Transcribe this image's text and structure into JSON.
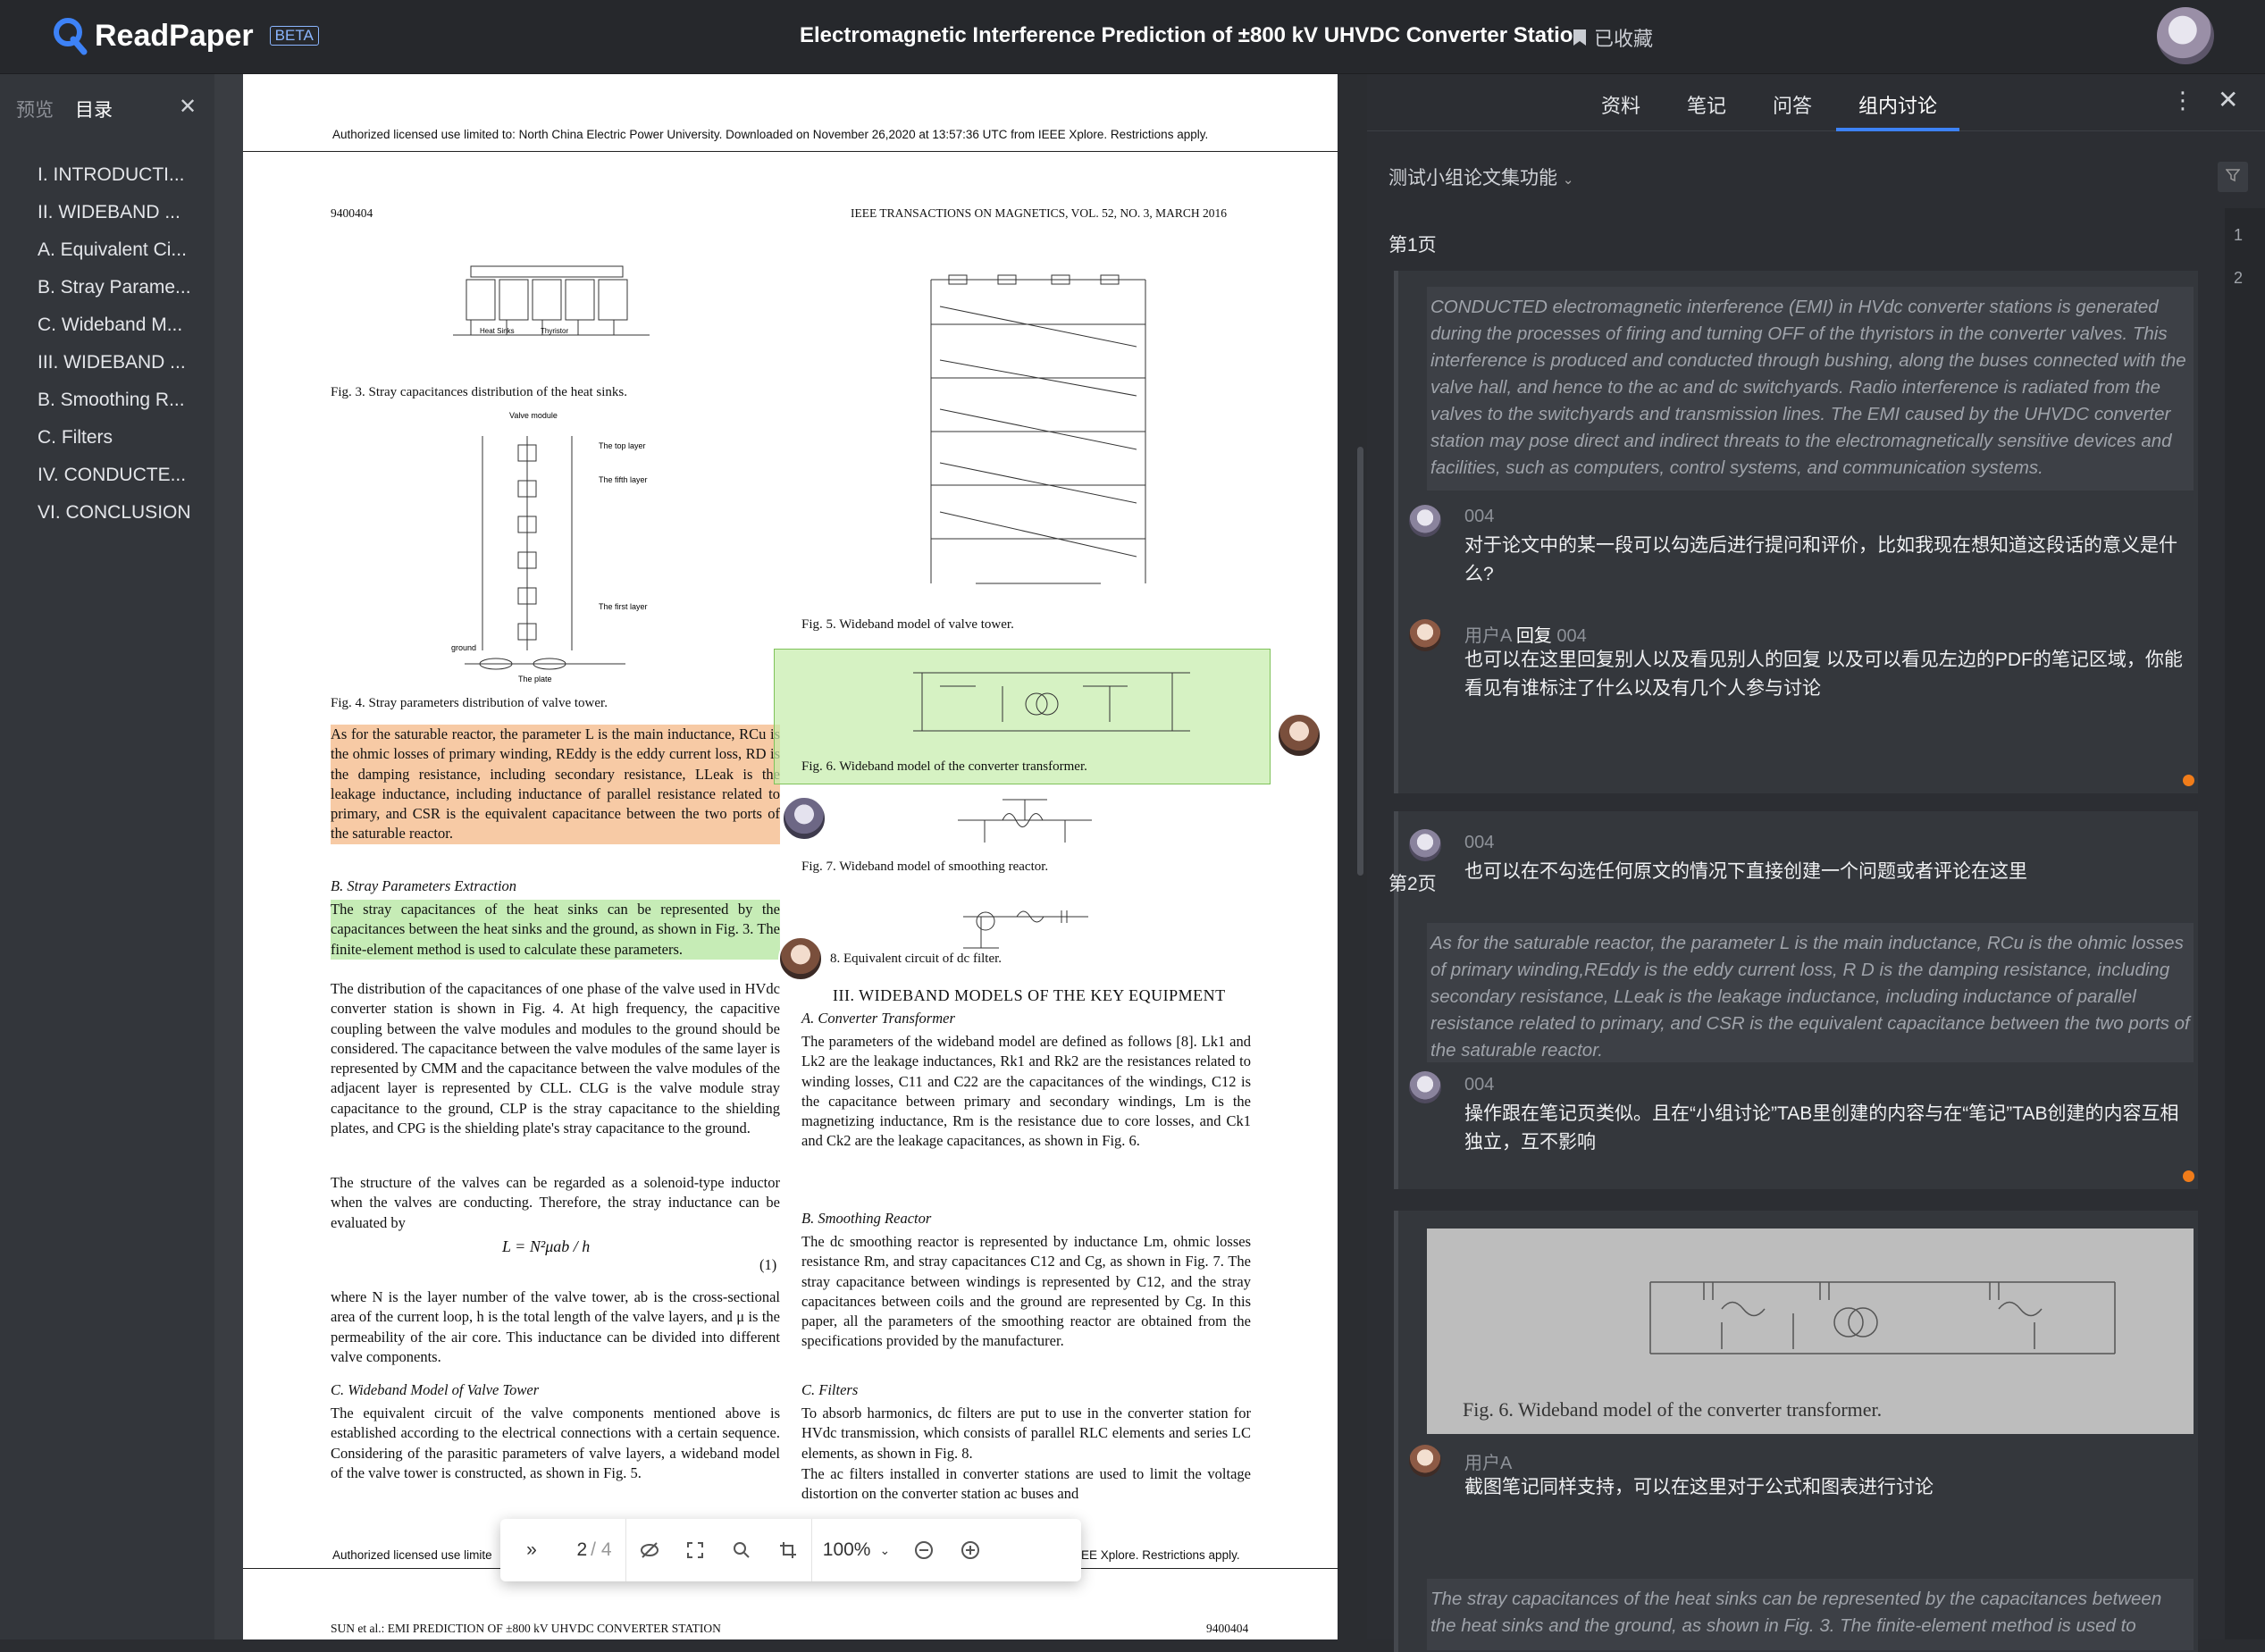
{
  "app": {
    "name": "ReadPaper",
    "badge": "BETA"
  },
  "header": {
    "title": "Electromagnetic Interference Prediction of ±800 kV UHVDC Converter Station",
    "favorite_label": "已收藏"
  },
  "left_panel": {
    "tabs": [
      "预览",
      "目录"
    ],
    "toc": [
      "I. INTRODUCTI...",
      "II. WIDEBAND ...",
      "A. Equivalent Ci...",
      "B. Stray Parame...",
      "C. Wideband M...",
      "III. WIDEBAND ...",
      "B. Smoothing R...",
      "C. Filters",
      "IV. CONDUCTE...",
      "VI. CONCLUSION"
    ]
  },
  "pdf": {
    "footer_top": "Authorized licensed use limited to: North China Electric Power University. Downloaded on November 26,2020 at 13:57:36 UTC from IEEE Xplore.  Restrictions apply.",
    "page_num": "9400404",
    "journal": "IEEE TRANSACTIONS ON MAGNETICS, VOL. 52, NO. 3, MARCH 2016",
    "fig3_caption": "Fig. 3.   Stray capacitances distribution of the heat sinks.",
    "fig4_caption": "Fig. 4.   Stray parameters distribution of valve tower.",
    "fig5_caption": "Fig. 5.   Wideband model of valve tower.",
    "fig6_caption": "Fig. 6.   Wideband model of the converter transformer.",
    "fig7_caption": "Fig. 7.   Wideband model of smoothing reactor.",
    "fig8_caption": "8.   Equivalent circuit of dc filter.",
    "para_saturable": "As for the saturable reactor, the parameter L is the main inductance, RCu is the ohmic losses of primary winding, REddy is the eddy current loss, RD is the damping resistance, including secondary resistance, LLeak is the leakage inductance, including inductance of parallel resistance related to primary, and CSR is the equivalent capacitance between the two ports of the saturable reactor.",
    "sec_b": "B. Stray Parameters Extraction",
    "para_stray_hl": "The stray capacitances of the heat sinks can be represented by the capacitances between the heat sinks and the ground, as shown in Fig. 3. The finite-element method is used to calculate these parameters.",
    "para_dist": "The distribution of the capacitances of one phase of the valve used in HVdc converter station is shown in Fig. 4. At high frequency, the capacitive coupling between the valve modules and modules to the ground should be considered. The capacitance between the valve modules of the same layer is represented by CMM and the capacitance between the valve modules of the adjacent layer is represented by CLL. CLG is the valve module stray capacitance to the ground, CLP is the stray capacitance to the shielding plates, and CPG is the shielding plate's stray capacitance to the ground.",
    "para_struct": "The structure of the valves can be regarded as a solenoid-type inductor when the valves are conducting. Therefore, the stray inductance can be evaluated by",
    "equation": "L = N²μab / h",
    "eq_num": "(1)",
    "para_where": "where N is the layer number of the valve tower, ab is the cross-sectional area of the current loop, h is the total length of the valve layers, and μ is the permeability of the air core. This inductance can be divided into different valve components.",
    "sec_c": "C. Wideband Model of Valve Tower",
    "para_equiv": "The equivalent circuit of the valve components mentioned above is established according to the electrical connections with a certain sequence. Considering of the parasitic parameters of valve layers, a wideband model of the valve tower is constructed, as shown in Fig. 5.",
    "sec_iii": "III. WIDEBAND MODELS OF THE KEY EQUIPMENT",
    "sec_iii_a": "A. Converter Transformer",
    "para_params": "The parameters of the wideband model are defined as follows [8]. Lk1 and Lk2 are the leakage inductances, Rk1 and Rk2 are the resistances related to winding losses, C11 and C22 are the capacitances of the windings, C12 is the capacitance between primary and secondary windings, Lm is the magnetizing inductance, Rm is the resistance due to core losses, and Ck1 and Ck2 are the leakage capacitances, as shown in Fig. 6.",
    "sec_iii_b": "B. Smoothing Reactor",
    "para_smooth": "The dc smoothing reactor is represented by inductance Lm, ohmic losses resistance Rm, and stray capacitances C12 and Cg, as shown in Fig. 7. The stray capacitance between windings is represented by C12, and the stray capacitances between coils and the ground are represented by Cg. In this paper, all the parameters of the smoothing reactor are obtained from the specifications provided by the manufacturer.",
    "sec_iii_c": "C. Filters",
    "para_filters": "To absorb harmonics, dc filters are put to use in the converter station for HVdc transmission, which consists of parallel RLC elements and series LC elements, as shown in Fig. 8.",
    "para_ac": "The ac filters installed in converter stations are used to limit the voltage distortion on the converter station ac buses and",
    "footer_bottom_left": "Authorized licensed use limite",
    "footer_bottom_right": "EE Xplore.  Restrictions apply.",
    "next_header_left": "SUN et al.: EMI PREDICTION OF ±800 kV UHVDC CONVERTER STATION",
    "next_header_right": "9400404",
    "fig_labels": {
      "heatsink": [
        "Heat Sinks",
        "Thyristor"
      ],
      "valve": [
        "Valve module",
        "The top layer",
        "The fifth layer",
        "The first layer",
        "The plate",
        "ground"
      ]
    }
  },
  "toolbar": {
    "page_current": "2",
    "page_total": "/ 4",
    "zoom": "100%"
  },
  "right_panel": {
    "tabs": [
      "资料",
      "笔记",
      "问答",
      "组内讨论"
    ],
    "active_tab": "组内讨论",
    "group": "测试小组论文集功能",
    "page1_label": "第1页",
    "page2_label": "第2页",
    "scroll_nums": [
      "1",
      "2"
    ],
    "card1": {
      "quote": "CONDUCTED electromagnetic interference (EMI) in HVdc converter stations is generated during the processes of firing and turning OFF of the thyristors in the converter valves. This interference is produced and conducted through bushing, along the buses connected with the valve hall, and hence to the ac and dc switchyards. Radio interference is radiated from the valves to the switchyards and transmission lines. The EMI caused by the UHVDC converter station may pose direct and indirect threats to the electromagnetically sensitive devices and facilities, such as computers, control systems, and communication systems.",
      "c1_name": "004",
      "c1_text": "对于论文中的某一段可以勾选后进行提问和评价，比如我现在想知道这段话的意义是什么?",
      "c2_name": "用户A",
      "c2_reply": "回复",
      "c2_target": "004",
      "c2_text": "也可以在这里回复别人以及看见别人的回复 以及可以看见左边的PDF的笔记区域，你能看见有谁标注了什么以及有几个人参与讨论",
      "dot": "#f07c1a"
    },
    "card2": {
      "name": "004",
      "text": "也可以在不勾选任何原文的情况下直接创建一个问题或者评论在这里",
      "dot": "#2f7cf6"
    },
    "card3": {
      "quote": "As for the saturable reactor, the parameter L is the main inductance, RCu is the ohmic losses of primary winding,REddy is the eddy current loss, R D is the damping resistance, including secondary resistance, LLeak is the leakage inductance, including inductance of parallel resistance related to primary, and CSR is the equivalent capacitance between the two ports of the saturable reactor.",
      "name": "004",
      "text": "操作跟在笔记页类似。且在“小组讨论”TAB里创建的内容与在“笔记”TAB创建的内容互相独立，互不影响",
      "dot": "#f07c1a"
    },
    "card4": {
      "caption": "Fig. 6.   Wideband model of the converter transformer.",
      "name": "用户A",
      "text": "截图笔记同样支持，可以在这里对于公式和图表进行讨论",
      "dot": "#52c41a"
    },
    "card5": {
      "quote": "The stray capacitances of the heat sinks can be represented by the capacitances between the heat sinks and the ground, as shown in Fig. 3. The finite-element method is used to"
    }
  }
}
